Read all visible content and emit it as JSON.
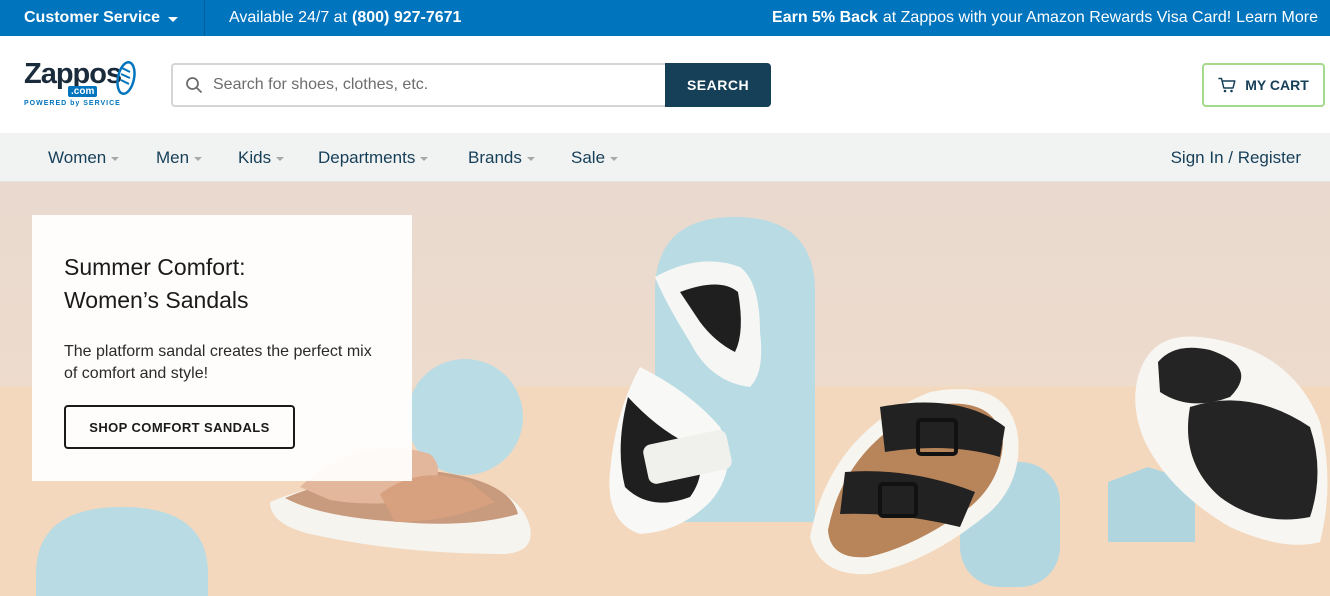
{
  "topbar": {
    "customer_service": "Customer Service",
    "available_prefix": "Available 24/7 at",
    "phone": "(800) 927-7671",
    "promo_bold": "Earn 5% Back",
    "promo_text": "at Zappos with your Amazon Rewards Visa Card!",
    "promo_link": "Learn More"
  },
  "header": {
    "logo_word": "Zappos",
    "logo_com": ".com",
    "logo_tagline": "POWERED by SERVICE",
    "search_placeholder": "Search for shoes, clothes, etc.",
    "search_button": "SEARCH",
    "cart_label": "MY CART"
  },
  "nav": {
    "items": [
      {
        "label": "Women"
      },
      {
        "label": "Men"
      },
      {
        "label": "Kids"
      },
      {
        "label": "Departments"
      },
      {
        "label": "Brands"
      },
      {
        "label": "Sale"
      }
    ],
    "signin": "Sign In / Register"
  },
  "hero": {
    "title_line1": "Summer Comfort:",
    "title_line2": "Women’s Sandals",
    "description": "The platform sandal creates the perfect mix of comfort and style!",
    "cta": "SHOP COMFORT SANDALS"
  },
  "colors": {
    "topbar": "#0074bd",
    "search_button": "#163f58",
    "cart_border": "#a5d98b",
    "nav_background": "#f1f2f2"
  }
}
